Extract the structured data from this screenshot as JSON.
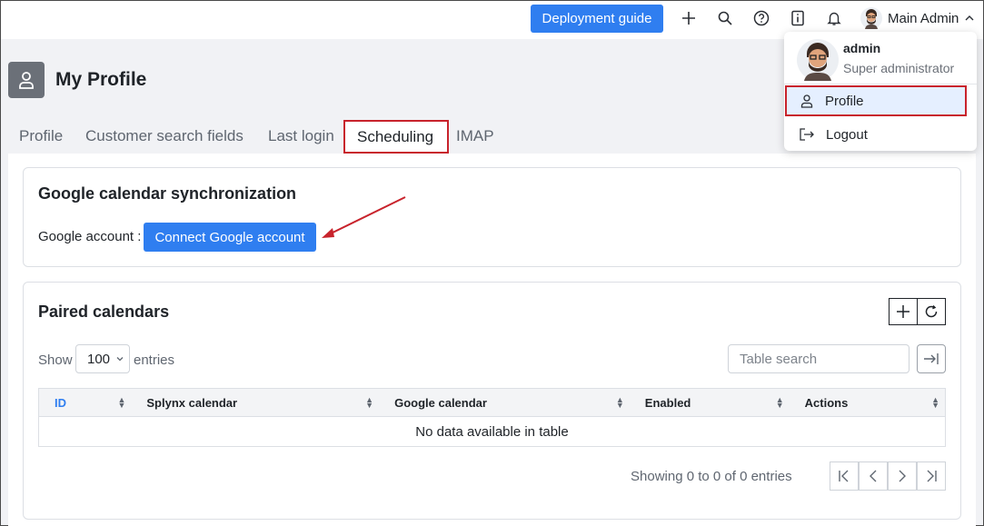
{
  "topbar": {
    "deploy_label": "Deployment guide",
    "icons": [
      "plus-icon",
      "search-icon",
      "help-icon",
      "info-icon",
      "bell-icon"
    ],
    "user_name": "Main Admin"
  },
  "page": {
    "title": "My Profile"
  },
  "tabs": [
    {
      "label": "Profile",
      "active": false
    },
    {
      "label": "Customer search fields",
      "active": false
    },
    {
      "label": "Last login",
      "active": false
    },
    {
      "label": "Scheduling",
      "active": true
    },
    {
      "label": "IMAP",
      "active": false
    }
  ],
  "google_sync": {
    "title": "Google calendar synchronization",
    "account_label": "Google account :",
    "connect_label": "Connect Google account"
  },
  "paired": {
    "title": "Paired calendars",
    "show_label": "Show",
    "entries_value": "100",
    "entries_label": "entries",
    "search_placeholder": "Table search",
    "columns": [
      "ID",
      "Splynx calendar",
      "Google calendar",
      "Enabled",
      "Actions"
    ],
    "empty_text": "No data available in table",
    "info_text": "Showing 0 to 0 of 0 entries"
  },
  "dropdown": {
    "name": "admin",
    "role": "Super administrator",
    "items": [
      {
        "label": "Profile",
        "icon": "user-icon",
        "active": true
      },
      {
        "label": "Logout",
        "icon": "logout-icon",
        "active": false
      }
    ]
  },
  "colors": {
    "accent": "#2f7ef0",
    "highlight": "#c8232c"
  }
}
